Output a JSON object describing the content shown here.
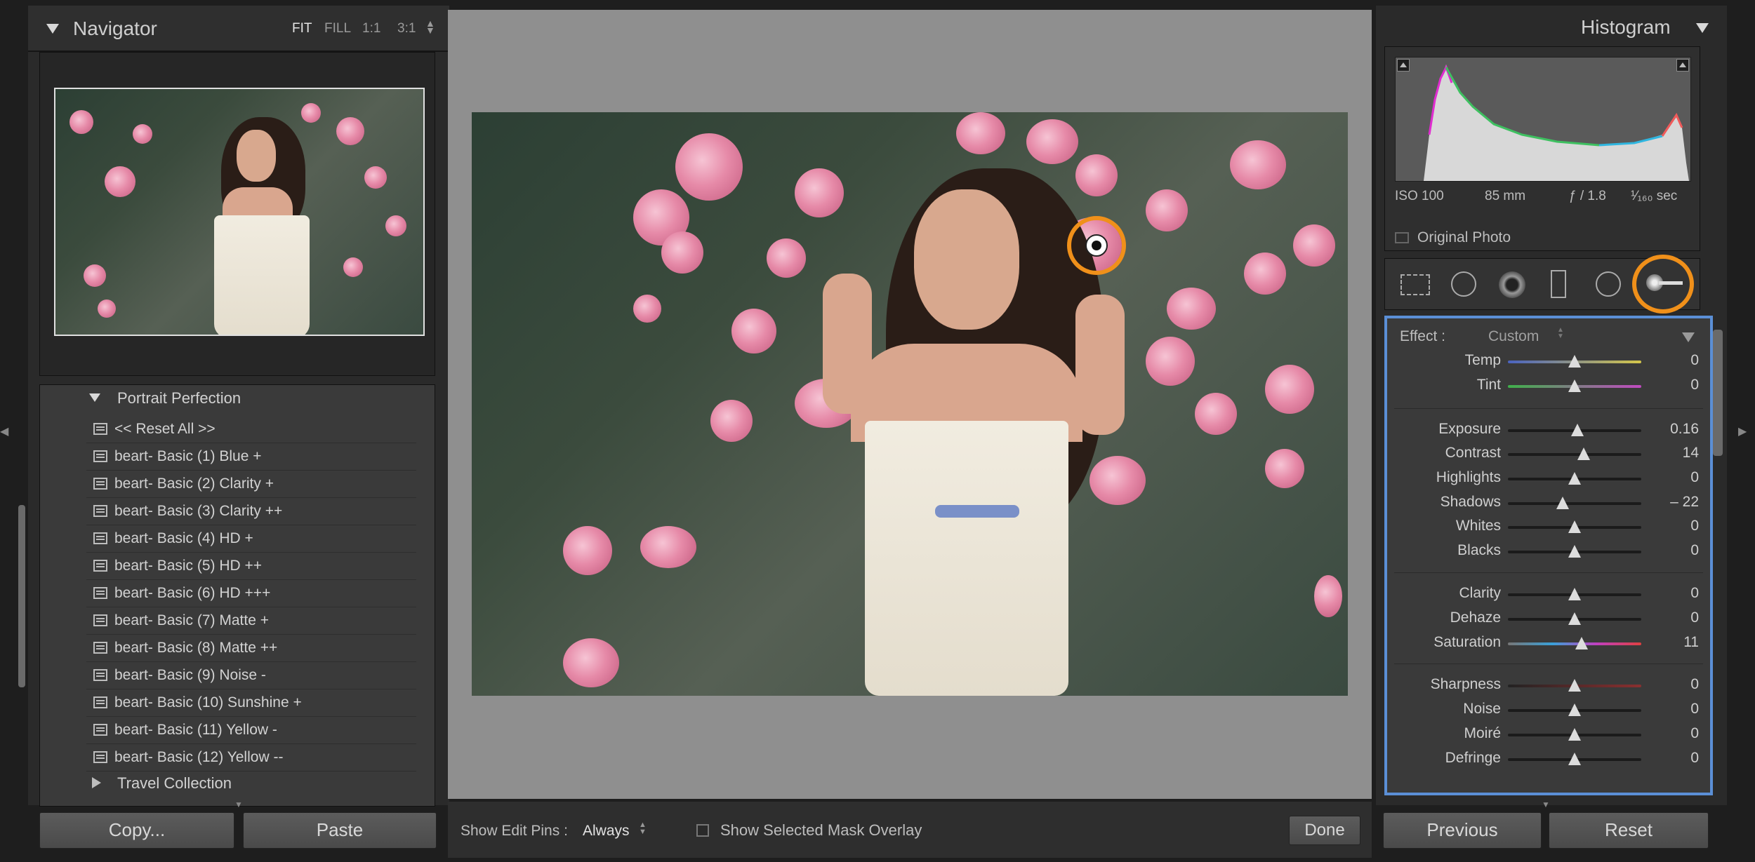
{
  "navigator": {
    "title": "Navigator",
    "zoom_options": [
      "FIT",
      "FILL",
      "1:1",
      "3:1"
    ]
  },
  "presets": {
    "group_open": "Portrait Perfection",
    "items": [
      "<< Reset All >>",
      "beart- Basic (1) Blue +",
      "beart- Basic (2) Clarity +",
      "beart- Basic (3) Clarity ++",
      "beart- Basic (4) HD +",
      "beart- Basic (5) HD ++",
      "beart- Basic (6) HD +++",
      "beart- Basic (7) Matte +",
      "beart- Basic (8) Matte ++",
      "beart- Basic (9) Noise -",
      "beart- Basic (10) Sunshine +",
      "beart- Basic (11) Yellow -",
      "beart- Basic (12) Yellow --"
    ],
    "group_closed": "Travel Collection"
  },
  "left_buttons": {
    "copy": "Copy...",
    "paste": "Paste"
  },
  "toolbar": {
    "show_edit_pins_label": "Show Edit Pins :",
    "show_edit_pins_value": "Always",
    "mask_overlay_label": "Show Selected Mask Overlay",
    "done": "Done"
  },
  "histogram": {
    "title": "Histogram",
    "iso": "ISO 100",
    "focal": "85 mm",
    "aperture": "ƒ / 1.8",
    "shutter": "¹⁄₁₆₀ sec",
    "original_photo": "Original Photo"
  },
  "tools": [
    "crop-overlay-icon",
    "spot-removal-icon",
    "red-eye-icon",
    "graduated-filter-icon",
    "radial-filter-icon",
    "adjustment-brush-icon"
  ],
  "effect": {
    "label": "Effect :",
    "value": "Custom"
  },
  "sliders": [
    {
      "label": "Temp",
      "value": "0",
      "pos": 0.5,
      "track": "temp"
    },
    {
      "label": "Tint",
      "value": "0",
      "pos": 0.5,
      "track": "tint"
    },
    {
      "label": "Exposure",
      "value": "0.16",
      "pos": 0.52,
      "track": "gray"
    },
    {
      "label": "Contrast",
      "value": "14",
      "pos": 0.57,
      "track": "gray"
    },
    {
      "label": "Highlights",
      "value": "0",
      "pos": 0.5,
      "track": "gray"
    },
    {
      "label": "Shadows",
      "value": "– 22",
      "pos": 0.41,
      "track": "gray"
    },
    {
      "label": "Whites",
      "value": "0",
      "pos": 0.5,
      "track": "gray"
    },
    {
      "label": "Blacks",
      "value": "0",
      "pos": 0.5,
      "track": "gray"
    },
    {
      "label": "Clarity",
      "value": "0",
      "pos": 0.5,
      "track": "gray"
    },
    {
      "label": "Dehaze",
      "value": "0",
      "pos": 0.5,
      "track": "gray"
    },
    {
      "label": "Saturation",
      "value": "11",
      "pos": 0.55,
      "track": "sat"
    },
    {
      "label": "Sharpness",
      "value": "0",
      "pos": 0.5,
      "track": "red"
    },
    {
      "label": "Noise",
      "value": "0",
      "pos": 0.5,
      "track": "gray"
    },
    {
      "label": "Moiré",
      "value": "0",
      "pos": 0.5,
      "track": "gray"
    },
    {
      "label": "Defringe",
      "value": "0",
      "pos": 0.5,
      "track": "gray"
    }
  ],
  "right_buttons": {
    "previous": "Previous",
    "reset": "Reset"
  },
  "colors": {
    "accent_ring": "#f0901a",
    "panel_highlight": "#5b8fd6"
  }
}
